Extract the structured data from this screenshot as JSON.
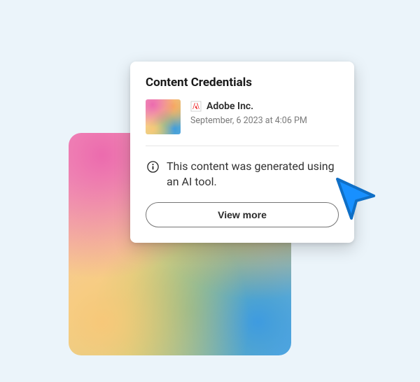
{
  "panel": {
    "title": "Content Credentials",
    "producer": "Adobe Inc.",
    "date": "September, 6 2023 at 4:06 PM",
    "message": "This content was generated using an AI tool.",
    "button_label": "View more"
  },
  "icons": {
    "logo": "adobe-logo-icon",
    "info": "info-icon",
    "cursor": "cursor-pointer-icon"
  }
}
